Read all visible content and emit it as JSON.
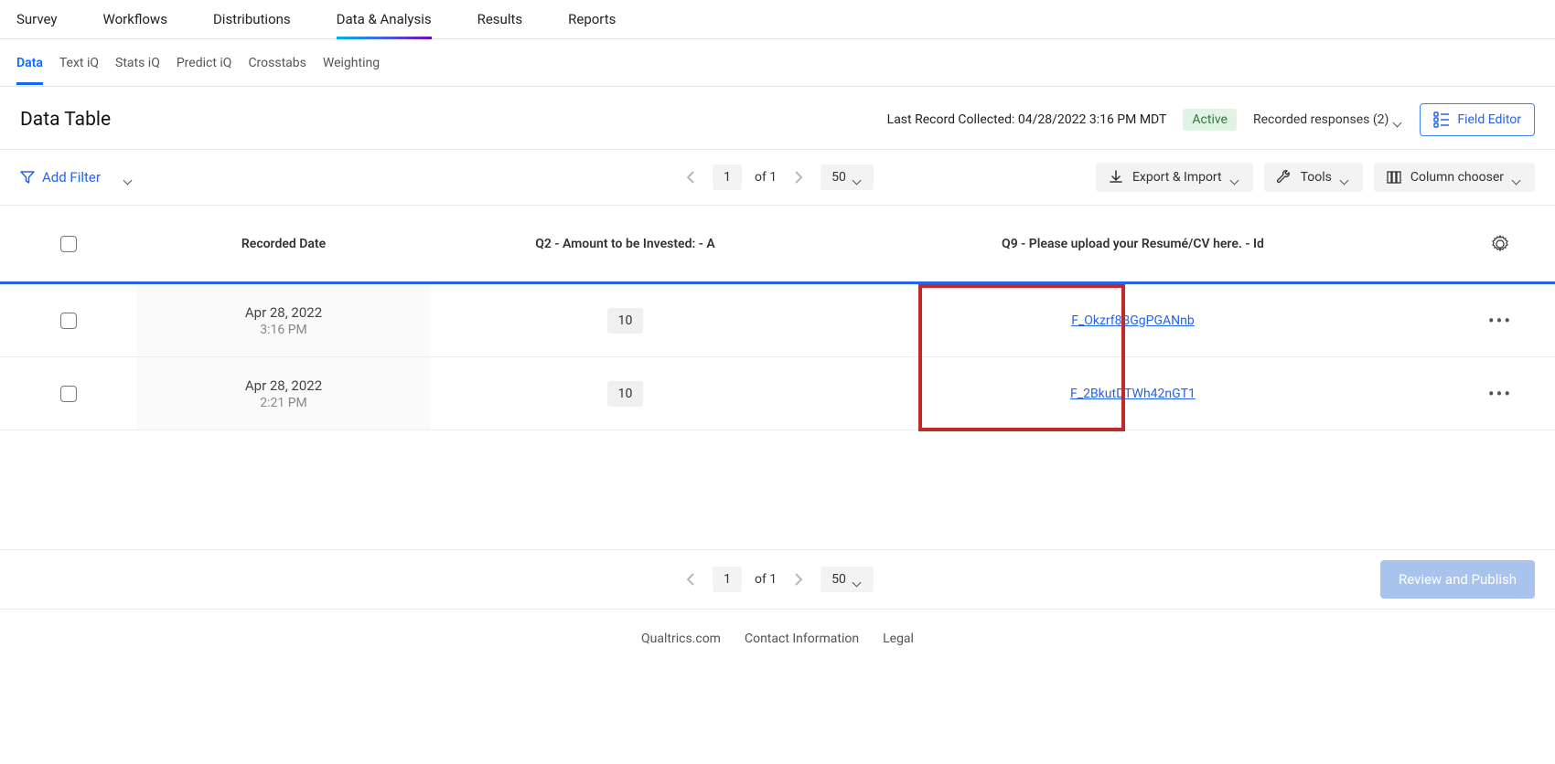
{
  "top_nav": {
    "items": [
      "Survey",
      "Workflows",
      "Distributions",
      "Data & Analysis",
      "Results",
      "Reports"
    ],
    "active_index": 3
  },
  "sub_nav": {
    "items": [
      "Data",
      "Text iQ",
      "Stats iQ",
      "Predict iQ",
      "Crosstabs",
      "Weighting"
    ],
    "active_index": 0
  },
  "title": "Data Table",
  "last_record": "Last Record Collected: 04/28/2022 3:16 PM MDT",
  "status_badge": "Active",
  "recorded_responses_label": "Recorded responses (2)",
  "field_editor_label": "Field Editor",
  "add_filter_label": "Add Filter",
  "pagination": {
    "current": "1",
    "of_label": "of 1",
    "page_size": "50"
  },
  "toolbar_buttons": {
    "export_import": "Export & Import",
    "tools": "Tools",
    "column_chooser": "Column chooser"
  },
  "table": {
    "headers": {
      "recorded_date": "Recorded Date",
      "amount": "Q2 - Amount to be Invested: - A",
      "file": "Q9 - Please upload your Resumé/CV here. - Id"
    },
    "rows": [
      {
        "date": "Apr 28, 2022",
        "time": "3:16 PM",
        "amount": "10",
        "file_id": "F_Okzrf8BGgPGANnb"
      },
      {
        "date": "Apr 28, 2022",
        "time": "2:21 PM",
        "amount": "10",
        "file_id": "F_2BkutDTWh42nGT1"
      }
    ]
  },
  "review_publish_label": "Review and Publish",
  "footer_links": [
    "Qualtrics.com",
    "Contact Information",
    "Legal"
  ]
}
